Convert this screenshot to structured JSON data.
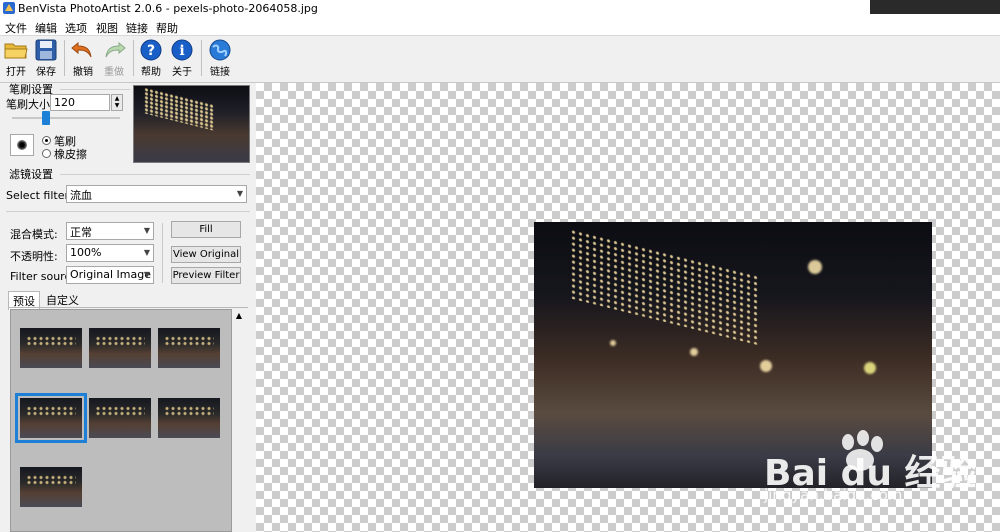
{
  "window": {
    "title": "BenVista PhotoArtist 2.0.6 - pexels-photo-2064058.jpg"
  },
  "menu": [
    "文件",
    "编辑",
    "选项",
    "视图",
    "链接",
    "帮助"
  ],
  "toolbar": {
    "open": "打开",
    "save": "保存",
    "undo": "撤销",
    "redo": "重做",
    "help": "帮助",
    "about": "关于",
    "link": "链接"
  },
  "brush": {
    "section_title": "笔刷设置",
    "size_label": "笔刷大小:",
    "size_value": "120",
    "slider_fraction": 0.33,
    "mode_brush": "笔刷",
    "mode_eraser": "橡皮擦",
    "selected_mode": "笔刷"
  },
  "filter": {
    "section_title": "滤镜设置",
    "select_label": "Select filter:",
    "select_value": "流血",
    "blend_label": "混合模式:",
    "blend_value": "正常",
    "opacity_label": "不透明性:",
    "opacity_value": "100%",
    "source_label": "Filter source:",
    "source_value": "Original Image",
    "fill_button": "Fill",
    "view_original_button": "View Original",
    "preview_button": "Preview Filter"
  },
  "tabs": [
    "预设",
    "自定义"
  ],
  "active_tab": "预设",
  "presets": {
    "count": 7,
    "selected_index": 3
  },
  "watermark": {
    "brand_text": "Bai du 经验",
    "url_text": "jingyan.baidu.com"
  },
  "colors": {
    "selection": "#1e7fd6",
    "help_icon": "#1a5fc8",
    "undo_icon": "#e07020"
  }
}
